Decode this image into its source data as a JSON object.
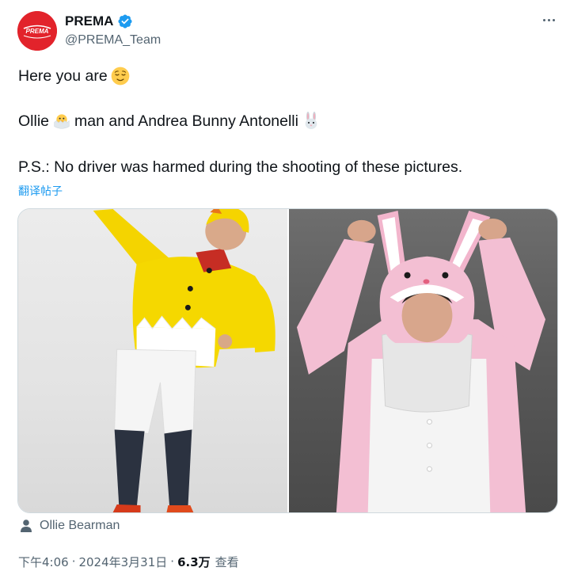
{
  "account": {
    "display_name": "PREMA",
    "handle": "@PREMA_Team",
    "avatar_text": "PREMA",
    "verified": true,
    "brand_color": "#e2232b",
    "verified_color": "#1d9bf0"
  },
  "tweet": {
    "line1_text": "Here you are",
    "line1_emoji": "relieved-face-emoji",
    "line2_start": "Ollie",
    "line2_emoji": "hatching-chick-emoji",
    "line2_end": "man and Andrea Bunny Antonelli",
    "line2_end_emoji": "rabbit-emoji",
    "line3_text": "P.S.: No driver was harmed during the shooting of these pictures.",
    "translate_label": "翻译帖子"
  },
  "media": {
    "photos": [
      {
        "subject": "person in yellow chick costume"
      },
      {
        "subject": "person in pink bunny costume"
      }
    ]
  },
  "tag": {
    "icon": "person-icon",
    "name": "Ollie Bearman"
  },
  "meta": {
    "time": "下午4:06",
    "separator": "·",
    "date": "2024年3月31日",
    "views": "6.3万",
    "views_label": "查看"
  },
  "colors": {
    "text_primary": "#0f1419",
    "text_secondary": "#536471",
    "link": "#1d9bf0"
  }
}
